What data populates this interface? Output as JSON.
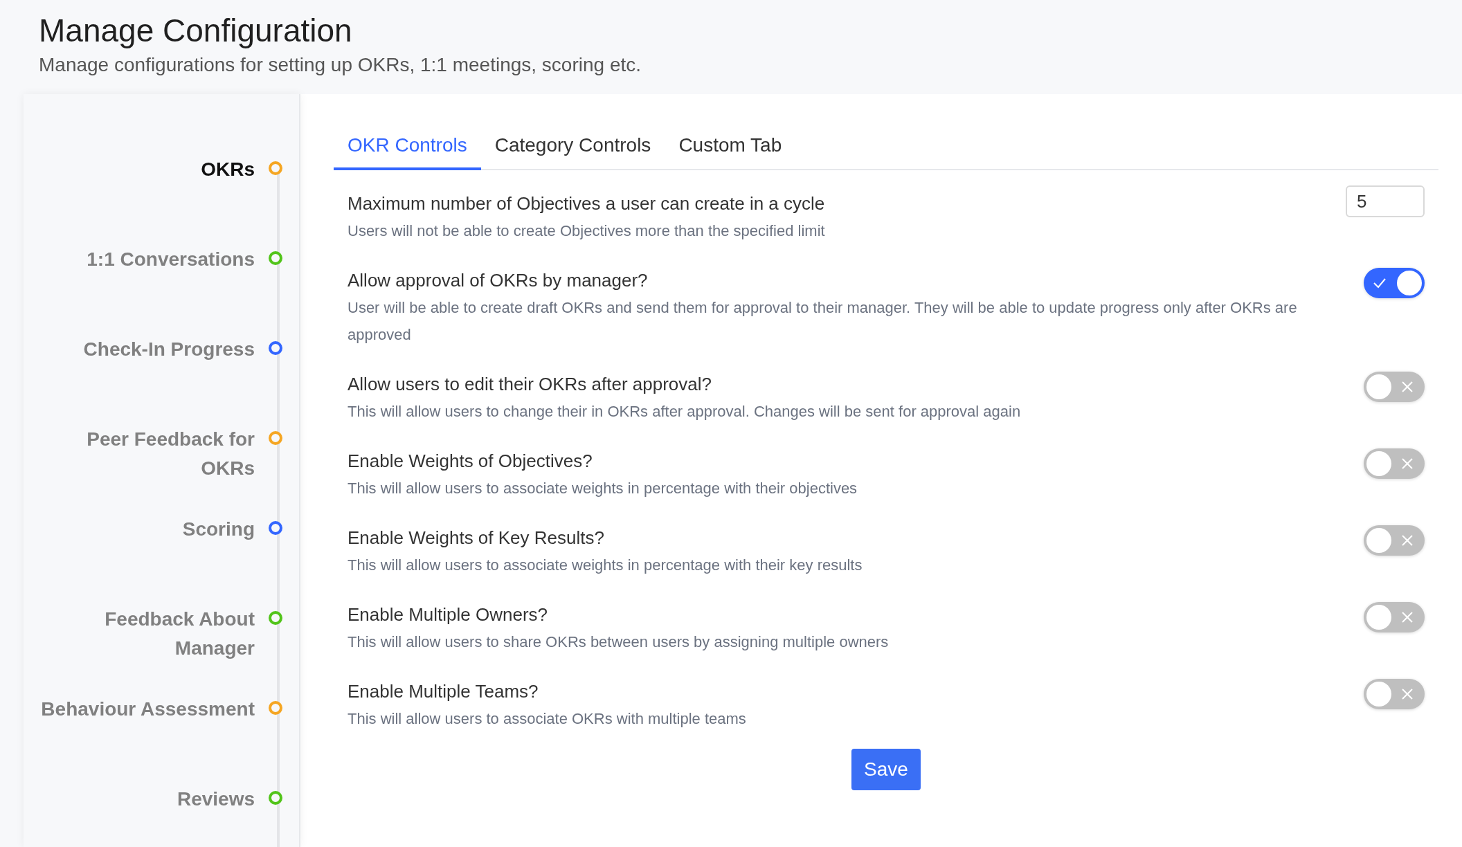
{
  "header": {
    "title": "Manage Configuration",
    "subtitle": "Manage configurations for setting up OKRs, 1:1 meetings, scoring etc."
  },
  "sidebar": {
    "items": [
      {
        "label": "OKRs",
        "selected": true,
        "color": "#f5a623"
      },
      {
        "label": "1:1 Conversations",
        "selected": false,
        "color": "#52c41a"
      },
      {
        "label": "Check-In Progress",
        "selected": false,
        "color": "#3366ff"
      },
      {
        "label": "Peer Feedback for OKRs",
        "selected": false,
        "color": "#f5a623"
      },
      {
        "label": "Scoring",
        "selected": false,
        "color": "#3366ff"
      },
      {
        "label": "Feedback About Manager",
        "selected": false,
        "color": "#52c41a"
      },
      {
        "label": "Behaviour Assessment",
        "selected": false,
        "color": "#f5a623"
      },
      {
        "label": "Reviews",
        "selected": false,
        "color": "#52c41a"
      }
    ]
  },
  "tabs": [
    {
      "label": "OKR Controls",
      "selected": true
    },
    {
      "label": "Category Controls",
      "selected": false
    },
    {
      "label": "Custom Tab",
      "selected": false
    }
  ],
  "settings": [
    {
      "kind": "number",
      "title": "Maximum number of Objectives a user can create in a cycle",
      "description": "Users will not be able to create Objectives more than the specified limit",
      "value": "5"
    },
    {
      "kind": "toggle",
      "title": "Allow approval of OKRs by manager?",
      "description": "User will be able to create draft OKRs and send them for approval to their manager. They will be able to update progress only after OKRs are approved",
      "on": true
    },
    {
      "kind": "toggle",
      "title": "Allow users to edit their OKRs after approval?",
      "description": "This will allow users to change their in OKRs after approval. Changes will be sent for approval again",
      "on": false
    },
    {
      "kind": "toggle",
      "title": "Enable Weights of Objectives?",
      "description": "This will allow users to associate weights in percentage with their objectives",
      "on": false
    },
    {
      "kind": "toggle",
      "title": "Enable Weights of Key Results?",
      "description": "This will allow users to associate weights in percentage with their key results",
      "on": false
    },
    {
      "kind": "toggle",
      "title": "Enable Multiple Owners?",
      "description": "This will allow users to share OKRs between users by assigning multiple owners",
      "on": false
    },
    {
      "kind": "toggle",
      "title": "Enable Multiple Teams?",
      "description": "This will allow users to associate OKRs with multiple teams",
      "on": false
    }
  ],
  "save_button": "Save"
}
